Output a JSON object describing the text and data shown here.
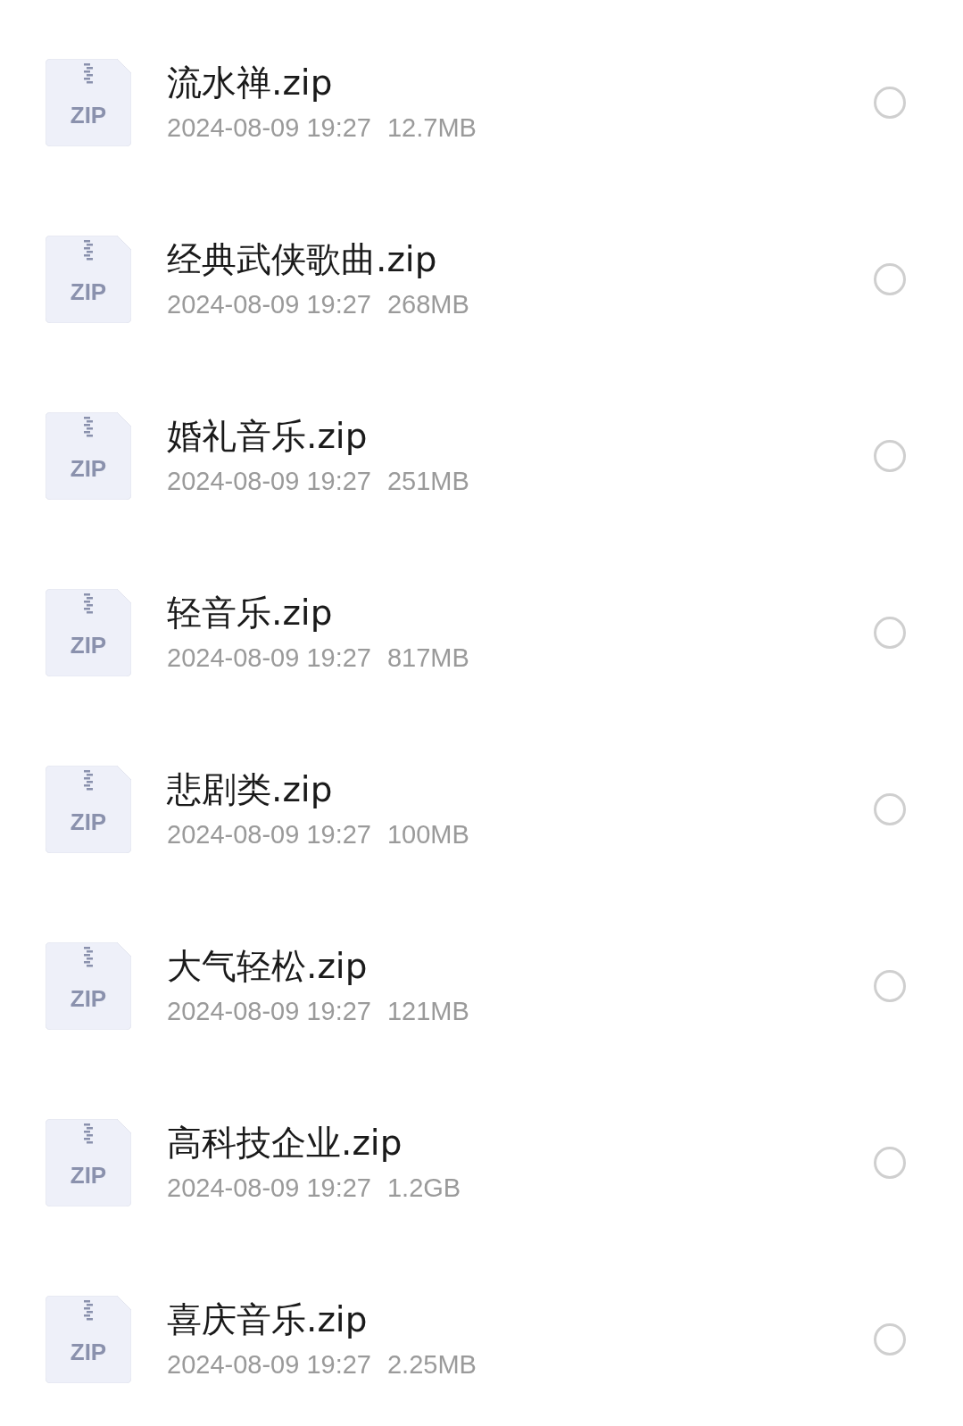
{
  "files": [
    {
      "icon_label": "ZIP",
      "name": "流水禅.zip",
      "date": "2024-08-09 19:27",
      "size": "12.7MB",
      "selected": false
    },
    {
      "icon_label": "ZIP",
      "name": "经典武侠歌曲.zip",
      "date": "2024-08-09 19:27",
      "size": "268MB",
      "selected": false
    },
    {
      "icon_label": "ZIP",
      "name": "婚礼音乐.zip",
      "date": "2024-08-09 19:27",
      "size": "251MB",
      "selected": false
    },
    {
      "icon_label": "ZIP",
      "name": "轻音乐.zip",
      "date": "2024-08-09 19:27",
      "size": "817MB",
      "selected": false
    },
    {
      "icon_label": "ZIP",
      "name": "悲剧类.zip",
      "date": "2024-08-09 19:27",
      "size": "100MB",
      "selected": false
    },
    {
      "icon_label": "ZIP",
      "name": "大气轻松.zip",
      "date": "2024-08-09 19:27",
      "size": "121MB",
      "selected": false
    },
    {
      "icon_label": "ZIP",
      "name": "高科技企业.zip",
      "date": "2024-08-09 19:27",
      "size": "1.2GB",
      "selected": false
    },
    {
      "icon_label": "ZIP",
      "name": "喜庆音乐.zip",
      "date": "2024-08-09 19:27",
      "size": "2.25MB",
      "selected": false
    }
  ]
}
